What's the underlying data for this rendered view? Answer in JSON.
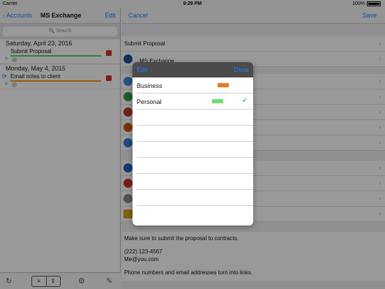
{
  "status": {
    "carrier": "Carrier",
    "time": "9:29 PM",
    "battery": "100%"
  },
  "left": {
    "back_label": "Accounts",
    "title": "MS Exchange",
    "edit_label": "Edit",
    "search_placeholder": "Search",
    "groups": [
      {
        "date": "Saturday, April 23, 2016",
        "task": "Submit Proposal",
        "bar_color": "#4cd964"
      },
      {
        "date": "Monday, May 4, 2015",
        "task": "Email notes to client",
        "bar_color": "#ff9500"
      }
    ]
  },
  "right": {
    "cancel_label": "Cancel",
    "save_label": "Save",
    "task_title": "Submit Proposal",
    "account": "MS Exchange",
    "notes": {
      "line1": "Make sure to submit the proposal to contracts.",
      "phone": "(222) 123-4567",
      "email": "Me@you.com",
      "hint": "Phone numbers and email addresses turn into links."
    }
  },
  "popover": {
    "edit_label": "Edit",
    "done_label": "Done",
    "items": [
      {
        "label": "Business",
        "color": "#f07b1e",
        "selected": false
      },
      {
        "label": "Personal",
        "color": "#6ee06e",
        "selected": true
      }
    ],
    "check_glyph": "✓"
  }
}
